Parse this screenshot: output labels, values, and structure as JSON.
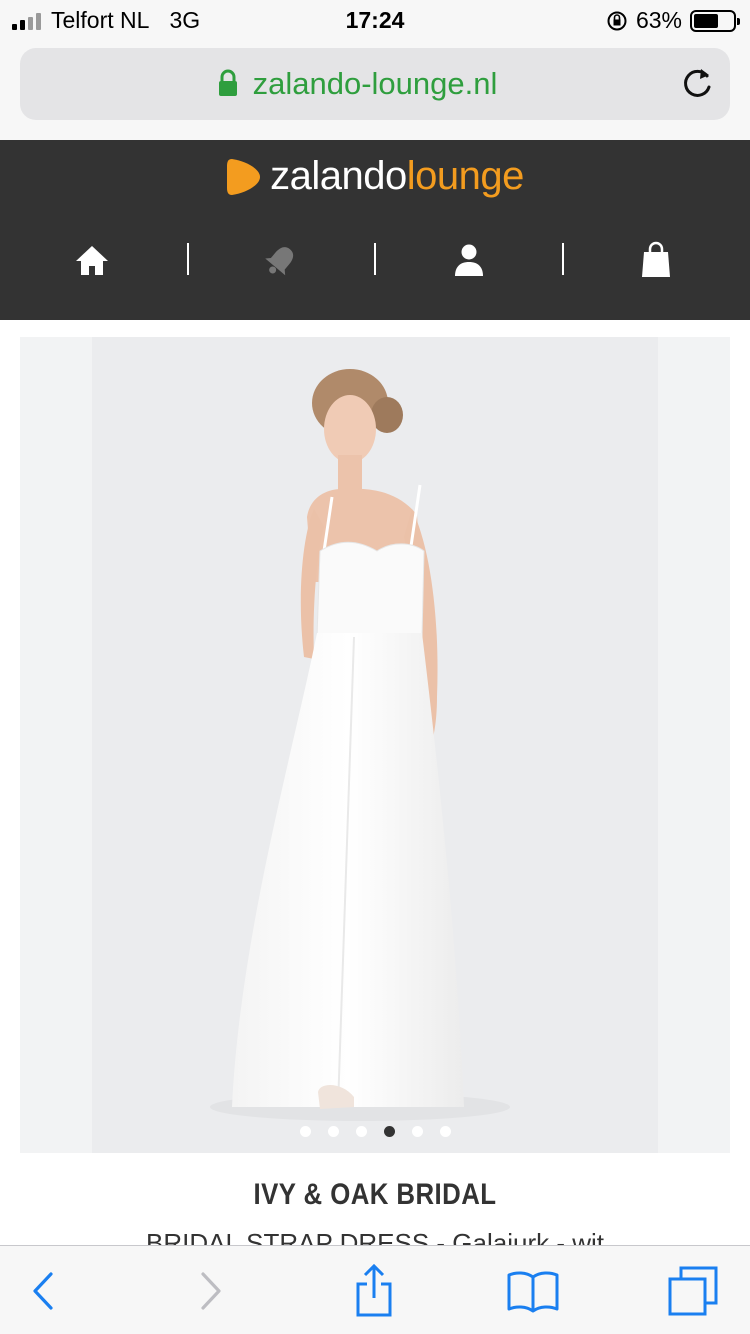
{
  "status_bar": {
    "carrier": "Telfort NL",
    "network": "3G",
    "time": "17:24",
    "battery_text": "63%",
    "battery_level": 0.63
  },
  "url_bar": {
    "url": "zalando-lounge.nl"
  },
  "header": {
    "logo_part1": "zalando",
    "logo_part2": "lounge",
    "nav_icons": [
      "home-icon",
      "bell-icon",
      "account-icon",
      "shopping-bag-icon"
    ]
  },
  "product": {
    "image_count": 6,
    "active_image_index": 3,
    "brand": "IVY & OAK BRIDAL",
    "subtitle": "BRIDAL STRAP DRESS - Galajurk - wit"
  },
  "toolbar": {
    "icons": [
      "back-icon",
      "forward-icon",
      "share-icon",
      "bookmarks-icon",
      "tabs-icon"
    ]
  },
  "colors": {
    "accent_orange": "#f39c1f",
    "header_bg": "#333333",
    "url_green": "#2f9e3e",
    "ios_blue": "#1a7ff0"
  }
}
